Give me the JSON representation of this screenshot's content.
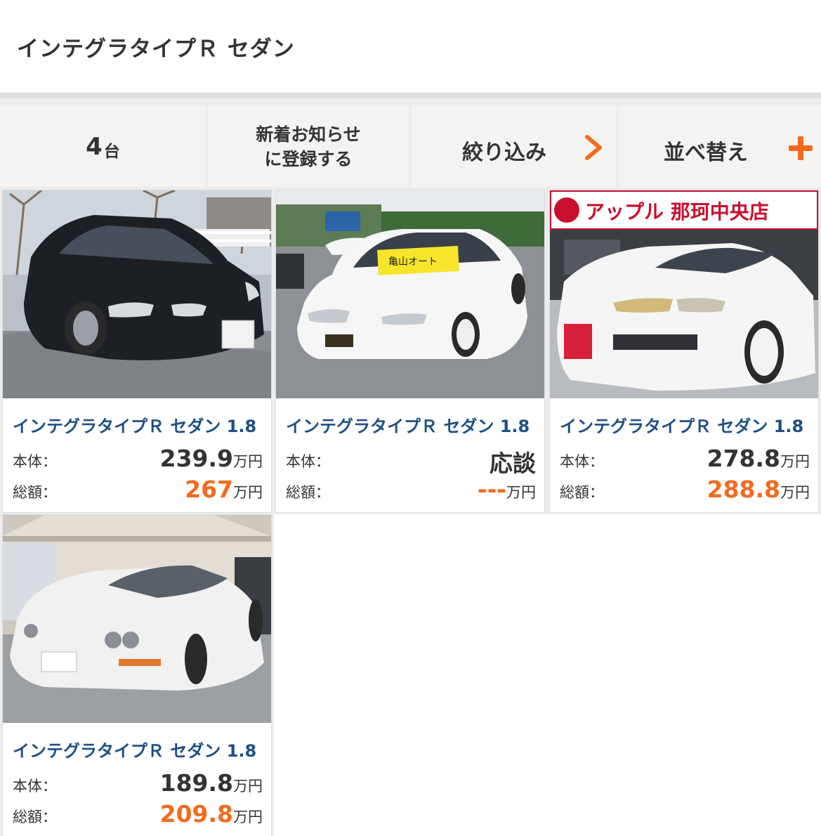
{
  "page": {
    "title": "インテグラタイプＲ セダン"
  },
  "toolbar": {
    "count_value": "4",
    "count_unit": "台",
    "notify_line1": "新着お知らせ",
    "notify_line2": "に登録する",
    "filter_label": "絞り込み",
    "filter_icon": "chevron-right-icon",
    "sort_label": "並べ替え",
    "sort_icon": "plus-icon"
  },
  "colors": {
    "accent": "#f26b1d",
    "link": "#1e4f84",
    "panel": "#ececec"
  },
  "listings": [
    {
      "name": "インテグラタイプＲ セダン 1.8",
      "body_label": "本体：",
      "body_price": "239.9",
      "body_unit": "万円",
      "total_label": "総額：",
      "total_price": "267",
      "total_unit": "万円"
    },
    {
      "name": "インテグラタイプＲ セダン 1.8",
      "body_label": "本体：",
      "body_price": "応談",
      "body_unit": "",
      "total_label": "総額：",
      "total_price": "---",
      "total_unit": "万円",
      "windshield_sign": "亀山オート"
    },
    {
      "name": "インテグラタイプＲ セダン 1.8",
      "body_label": "本体：",
      "body_price": "278.8",
      "body_unit": "万円",
      "total_label": "総額：",
      "total_price": "288.8",
      "total_unit": "万円",
      "shop_banner": "アップル 那珂中央店"
    },
    {
      "name": "インテグラタイプＲ セダン 1.8",
      "body_label": "本体：",
      "body_price": "189.8",
      "body_unit": "万円",
      "total_label": "総額：",
      "total_price": "209.8",
      "total_unit": "万円"
    }
  ]
}
